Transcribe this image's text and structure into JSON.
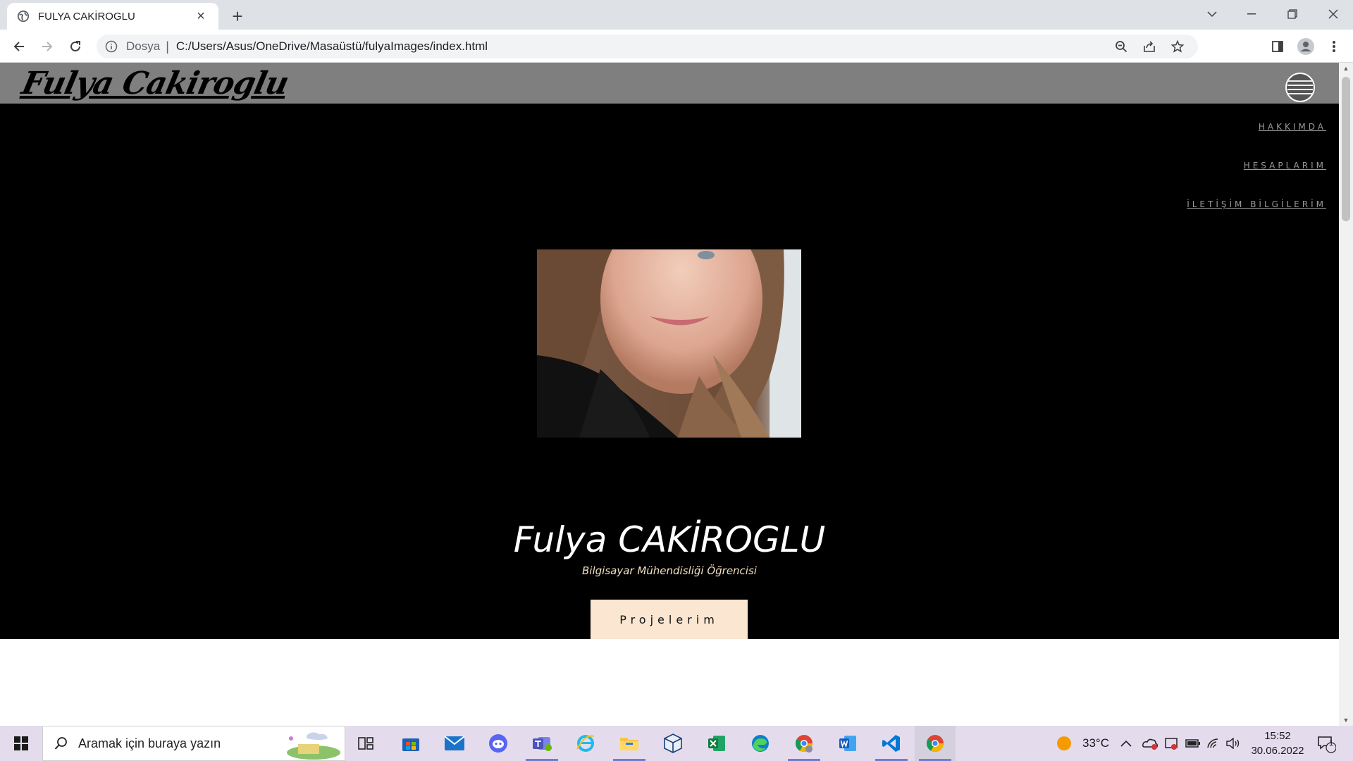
{
  "browser": {
    "tab_title": "FULYA CAKİROGLU",
    "tab_close": "×",
    "new_tab": "+",
    "address_scheme": "Dosya",
    "address_separator": "|",
    "address_url": "C:/Users/Asus/OneDrive/Masaüstü/fulyaImages/index.html"
  },
  "site": {
    "logo": "Fulya Cakiroglu",
    "menu": [
      "HAKKIMDA",
      "HESAPLARIM",
      "İLETİŞİM BİLGİLERİM"
    ],
    "name": "Fulya CAKİROGLU",
    "subtitle": "Bilgisayar Mühendisliği Öğrencisi",
    "button": "Projelerim"
  },
  "taskbar": {
    "search_placeholder": "Aramak için buraya yazın",
    "weather": "33°C",
    "time": "15:52",
    "date": "30.06.2022",
    "notification_count": "1"
  },
  "colors": {
    "header_bg": "#7f7f7f",
    "hero_bg": "#000000",
    "button_bg": "#fae6d1",
    "subtitle": "#f3dfc3",
    "taskbar_bg": "#e4dced"
  }
}
